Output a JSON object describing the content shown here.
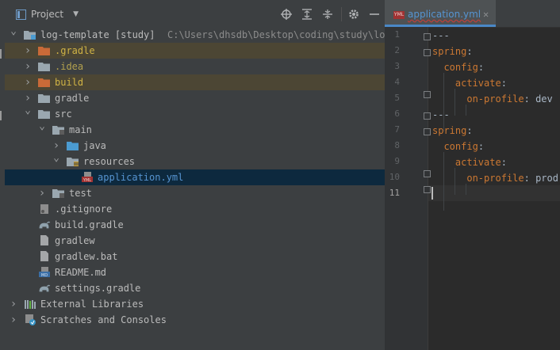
{
  "toolbar": {
    "project_label": "Project",
    "icons": [
      "locate-icon",
      "expand-all-icon",
      "collapse-all-icon",
      "settings-icon",
      "hide-icon"
    ]
  },
  "tree": [
    {
      "label": "log-template [study]",
      "path": "C:\\Users\\dhsdb\\Desktop\\coding\\study\\log-template",
      "depth": 0,
      "expanded": true,
      "icon": "module-folder-icon"
    },
    {
      "label": ".gradle",
      "depth": 1,
      "expanded": false,
      "icon": "excluded-folder-icon",
      "highlight": true
    },
    {
      "label": ".idea",
      "depth": 1,
      "expanded": false,
      "icon": "folder-icon"
    },
    {
      "label": "build",
      "depth": 1,
      "expanded": false,
      "icon": "excluded-folder-icon",
      "highlight": true
    },
    {
      "label": "gradle",
      "depth": 1,
      "expanded": false,
      "icon": "folder-icon"
    },
    {
      "label": "src",
      "depth": 1,
      "expanded": true,
      "icon": "folder-icon"
    },
    {
      "label": "main",
      "depth": 2,
      "expanded": true,
      "icon": "source-folder-icon"
    },
    {
      "label": "java",
      "depth": 3,
      "expanded": false,
      "icon": "java-folder-icon"
    },
    {
      "label": "resources",
      "depth": 3,
      "expanded": true,
      "icon": "resources-folder-icon"
    },
    {
      "label": "application.yml",
      "depth": 4,
      "icon": "yml-file-icon",
      "selected": true
    },
    {
      "label": "test",
      "depth": 2,
      "expanded": false,
      "icon": "source-folder-icon"
    },
    {
      "label": ".gitignore",
      "depth": 1,
      "icon": "gitignore-file-icon"
    },
    {
      "label": "build.gradle",
      "depth": 1,
      "icon": "gradle-file-icon"
    },
    {
      "label": "gradlew",
      "depth": 1,
      "icon": "file-icon"
    },
    {
      "label": "gradlew.bat",
      "depth": 1,
      "icon": "file-icon"
    },
    {
      "label": "README.md",
      "depth": 1,
      "icon": "markdown-file-icon"
    },
    {
      "label": "settings.gradle",
      "depth": 1,
      "icon": "gradle-file-icon"
    },
    {
      "label": "External Libraries",
      "depth": 0,
      "expanded": false,
      "icon": "libraries-icon"
    },
    {
      "label": "Scratches and Consoles",
      "depth": 0,
      "expanded": false,
      "icon": "scratches-icon"
    }
  ],
  "editor": {
    "tab_label": "application.yml",
    "file_badge": "YML",
    "lines": [
      {
        "n": "1",
        "text": "---"
      },
      {
        "n": "2",
        "key": "spring",
        "sep": ":"
      },
      {
        "n": "3",
        "indent": "  ",
        "key": "config",
        "sep": ":"
      },
      {
        "n": "4",
        "indent": "    ",
        "key": "activate",
        "sep": ":"
      },
      {
        "n": "5",
        "indent": "      ",
        "key": "on-profile",
        "sep": ": ",
        "value": "dev"
      },
      {
        "n": "6",
        "text": "---"
      },
      {
        "n": "7",
        "key": "spring",
        "sep": ":"
      },
      {
        "n": "8",
        "indent": "  ",
        "key": "config",
        "sep": ":"
      },
      {
        "n": "9",
        "indent": "    ",
        "key": "activate",
        "sep": ":"
      },
      {
        "n": "10",
        "indent": "      ",
        "key": "on-profile",
        "sep": ": ",
        "value": "prod"
      },
      {
        "n": "11",
        "text": ""
      }
    ]
  },
  "colors": {
    "highlight_row": "#4c4634",
    "selected_row": "#0d293e",
    "yaml_key": "#cc7832",
    "tab_accent": "#4a88c7"
  }
}
